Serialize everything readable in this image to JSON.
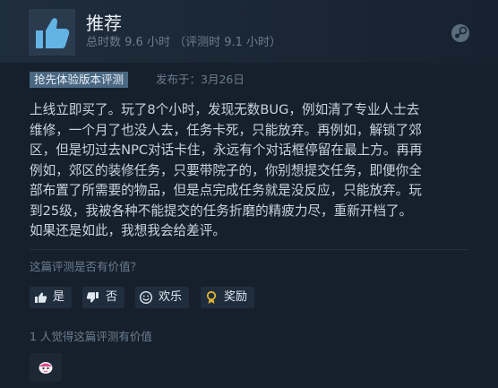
{
  "review": {
    "recommendation": "推荐",
    "hours": "总时数 9.6 小时 （评测时 9.1 小时）",
    "badge": "抢先体验版本评测",
    "posted": "发布于：3月26日",
    "lines": [
      "上线立即买了。玩了8个小时，发现无数BUG，例如清了专业人士去",
      "维修，一个月了也没人去，任务卡死，只能放弃。再例如，解锁了郊",
      "区，但是切过去NPC对话卡住，永远有个对话框停留在最上方。再再",
      "例如，郊区的装修任务，只要带院子的，你别想提交任务，即便你全",
      "部布置了所需要的物品，但是点完成任务就是没反应，只能放弃。玩",
      "到25级，我被各种不能提交的任务折磨的精疲力尽，重新开档了。",
      "如果还是如此，我想我会给差评。"
    ]
  },
  "helpful": {
    "question": "这篇评测是否有价值？",
    "yes": "是",
    "no": "否",
    "funny": "欢乐",
    "award": "奖励",
    "summary": "1 人觉得这篇评测有价值"
  },
  "icons": {
    "recommend": "thumbs-up-icon",
    "platform": "steam-logo-icon",
    "yes": "thumbs-up-icon",
    "no": "thumbs-down-icon",
    "funny": "smiley-icon",
    "award": "award-ribbon-icon",
    "award_chip": "award-emoji-icon"
  },
  "colors": {
    "background": "#16202d",
    "thumb_accent": "#63b3e4",
    "badge_bg": "#4a6882",
    "award_gold": "#e0b534"
  }
}
